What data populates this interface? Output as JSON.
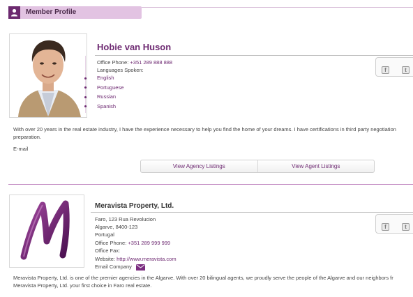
{
  "header": {
    "title": "Member Profile",
    "icon": "user-icon"
  },
  "agent": {
    "name": "Hobie van Huson",
    "phone_label": "Office Phone:",
    "phone": "+351 289 888 888",
    "languages_label": "Languages Spoken:",
    "languages": [
      "English",
      "Portuguese",
      "Russian",
      "Spanish"
    ],
    "bio_line1": "With over 20 years in the real estate industry, I have the experience necessary to help you find the home of your dreams. I have certifications in third party negotiation",
    "bio_line2": "preparation.",
    "email_label": "E-mail"
  },
  "social": {
    "facebook": "f",
    "twitter": "t"
  },
  "buttons": {
    "agency_listings": "View Agency Listings",
    "agent_listings": "View Agent Listings"
  },
  "company": {
    "name": "Meravista Property, Ltd.",
    "address1": "Faro, 123 Rua Revolucion",
    "address2": "Algarve, 8400-123",
    "country": "Portugal",
    "phone_label": "Office Phone:",
    "phone": "+351 289 999 999",
    "fax_label": "Office Fax:",
    "website_label": "Website:",
    "website": "http://www.meravista.com",
    "email_label": "Email Company",
    "bio_line1": "Meravista Property, Ltd. is one of the premier agencies in the Algarve. With over 20 bilingual agents, we proudly serve the people of the Algarve and our neighbors fr",
    "bio_line2": "Meravista Property, Ltd. your first choice in Faro real estate.",
    "logo_letter": "M"
  }
}
